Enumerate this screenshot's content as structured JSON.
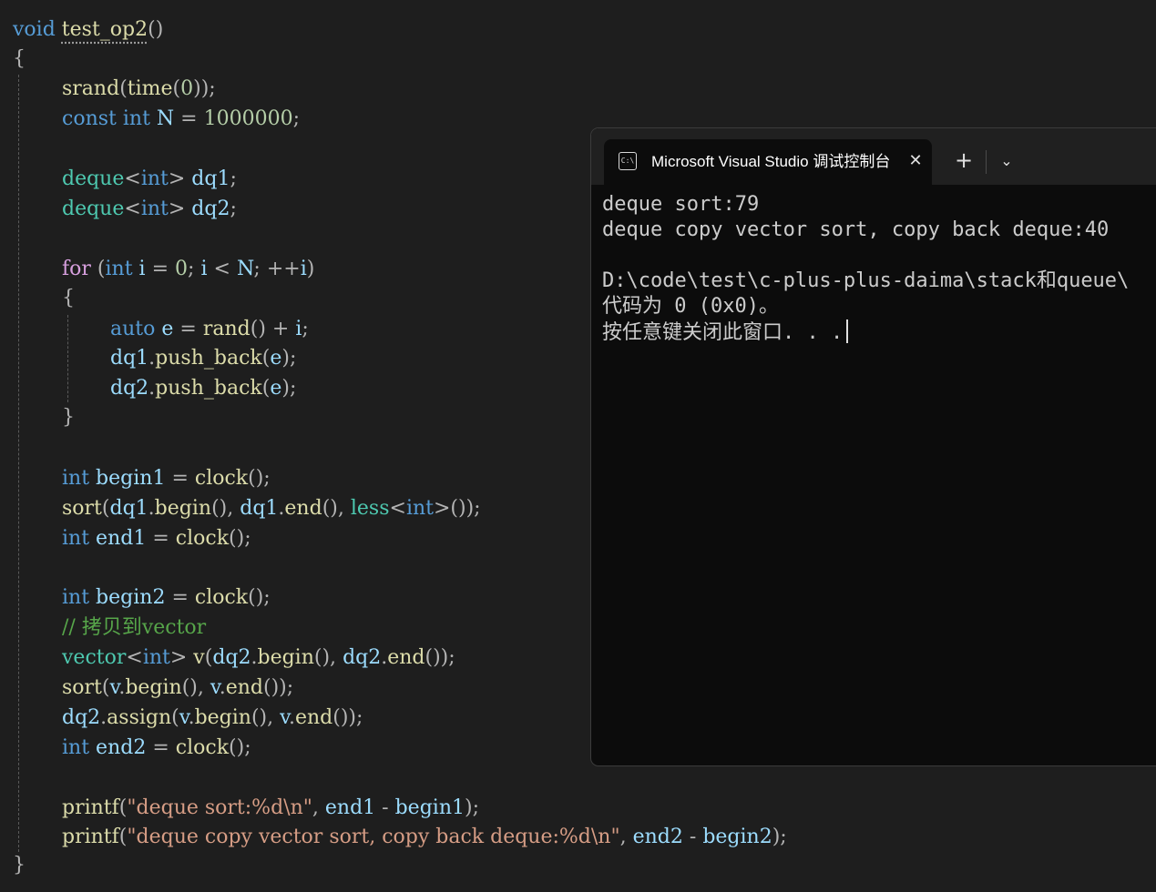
{
  "editor": {
    "function_name": "test_op2",
    "comment": "// 拷贝到vector",
    "printf1_format": "\"deque sort:%d\\n\"",
    "printf2_format": "\"deque copy vector sort, copy back deque:%d\\n\""
  },
  "terminal": {
    "tab_title": "Microsoft Visual Studio 调试控制台",
    "tab_icon_text": "C:\\",
    "close_icon": "close-icon",
    "new_tab_icon": "plus-icon",
    "dropdown_icon": "chevron-down-icon",
    "output": [
      "deque sort:79",
      "deque copy vector sort, copy back deque:40",
      "",
      "D:\\code\\test\\c-plus-plus-daima\\stack和queue\\",
      "代码为 0 (0x0)。",
      "按任意键关闭此窗口. . ."
    ]
  }
}
